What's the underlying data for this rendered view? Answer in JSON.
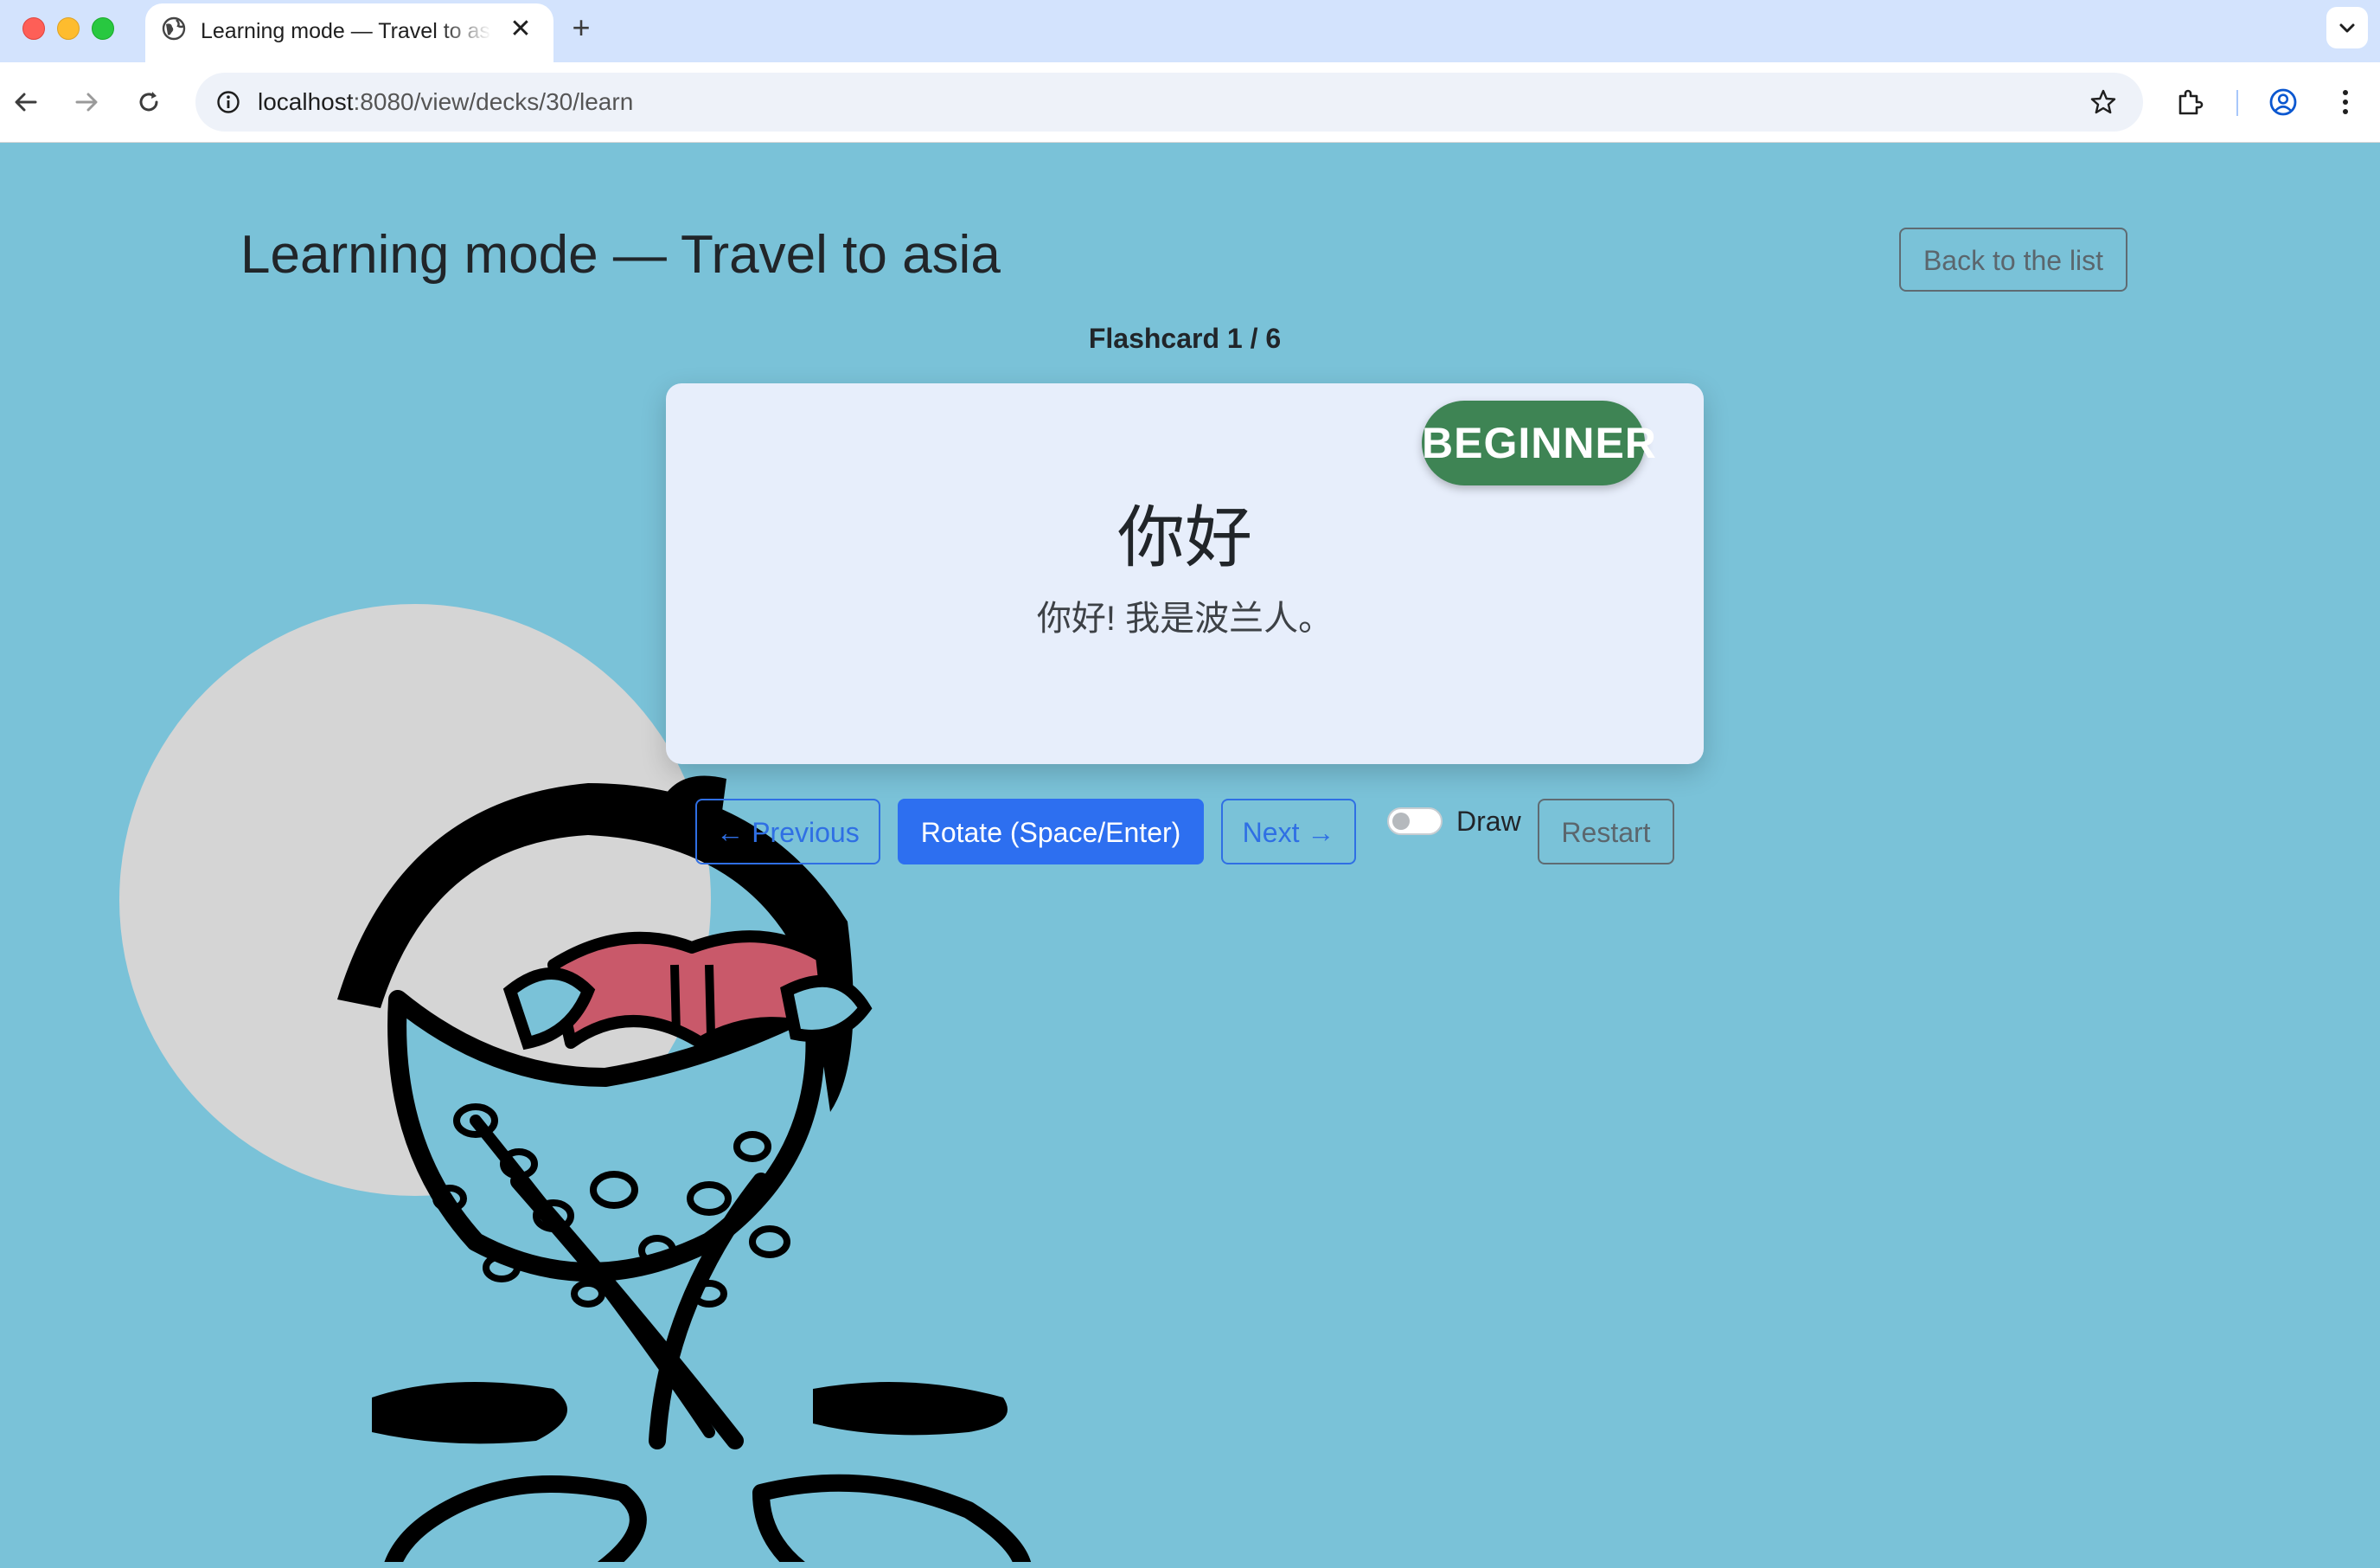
{
  "browser": {
    "tab_title": "Learning mode — Travel to asia",
    "tab_close": "✕",
    "new_tab": "+",
    "url_host": "localhost",
    "url_rest": ":8080/view/decks/30/learn"
  },
  "page": {
    "title": "Learning mode — Travel to asia",
    "back_button": "Back to the list",
    "counter": "Flashcard 1 / 6"
  },
  "card": {
    "level_badge": "BEGINNER",
    "word": "你好",
    "sentence": "你好! 我是波兰人。"
  },
  "controls": {
    "previous": "← Previous",
    "rotate": "Rotate (Space/Enter)",
    "next": "Next →",
    "draw_label": "Draw",
    "draw_enabled": false,
    "restart": "Restart"
  },
  "colors": {
    "page_background": "#7ac2d8",
    "card_background": "#e7eefb",
    "badge": "#3e8454",
    "primary": "#2d6ff0"
  },
  "icons": [
    "globe-icon",
    "back-arrow-icon",
    "forward-arrow-icon",
    "reload-icon",
    "site-info-icon",
    "bookmark-star-icon",
    "extensions-icon",
    "profile-icon",
    "more-menu-icon",
    "tab-search-chevron-icon"
  ]
}
